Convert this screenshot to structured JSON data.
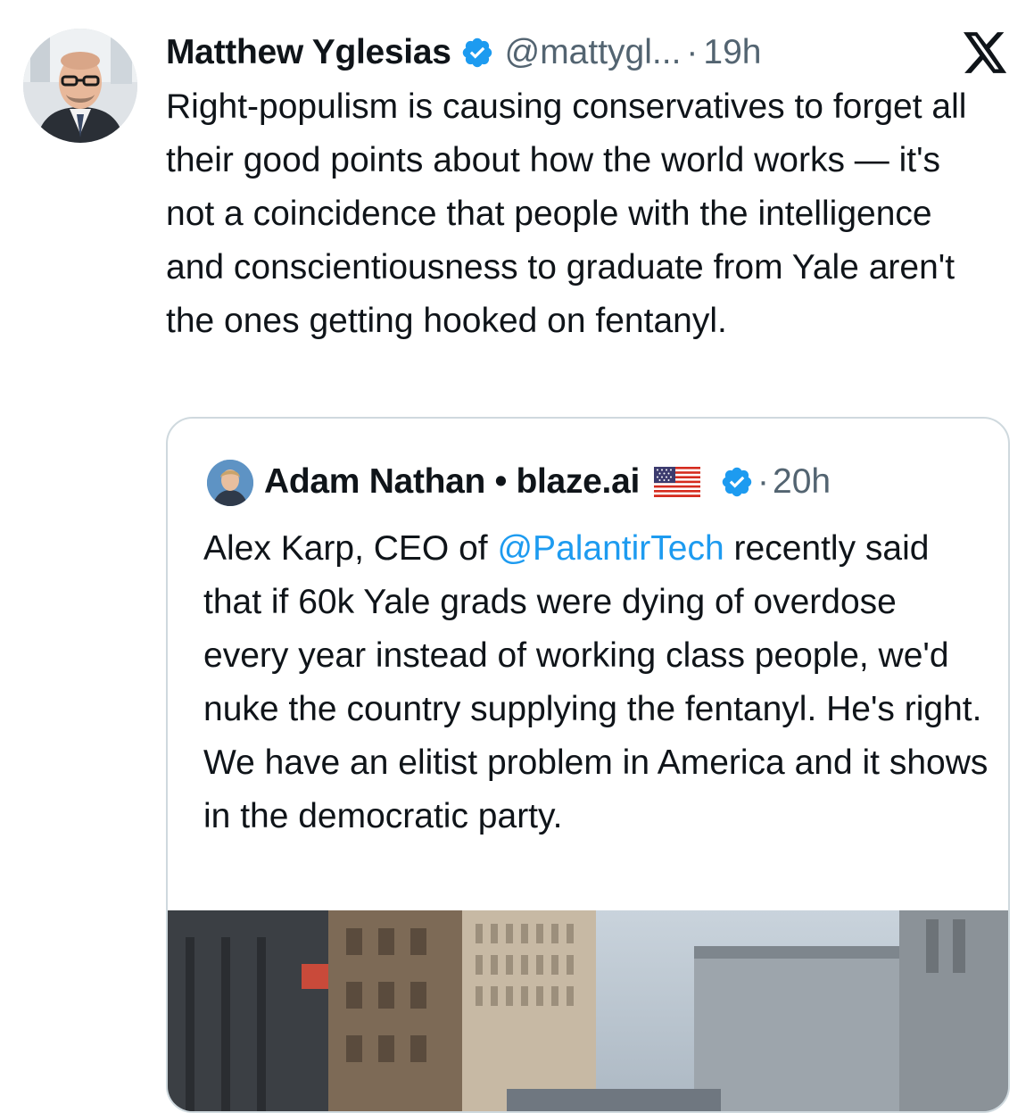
{
  "tweet": {
    "author_name": "Matthew Yglesias",
    "handle": "@mattygl...",
    "separator": "·",
    "time": "19h",
    "avatar_icon": "author-avatar",
    "verified_icon": "verified-badge-icon",
    "platform_icon": "x-logo-icon",
    "text": "Right-populism is causing conservatives to forget all their good points about how the world works — it's not a coincidence that people with the intelligence and conscientiousness to graduate from Yale aren't the ones getting hooked on fentanyl."
  },
  "quoted_tweet": {
    "author_name": "Adam Nathan • blaze.ai",
    "flag_icon": "us-flag-icon",
    "verified_icon": "verified-badge-icon",
    "separator": "·",
    "time": "20h",
    "text_before_mention": "Alex Karp, CEO of ",
    "mention": "@PalantirTech",
    "text_after_mention": " recently said that if 60k Yale grads were dying of overdose every year instead of working class people,  we'd nuke the country supplying the fentanyl. He's right. We have an elitist problem in America and it shows in the democratic party.",
    "media_icon": "street-photo"
  },
  "colors": {
    "text_primary": "#0f1419",
    "text_secondary": "#536471",
    "link": "#1d9bf0",
    "verified": "#1d9bf0",
    "border": "#cfd9de"
  }
}
